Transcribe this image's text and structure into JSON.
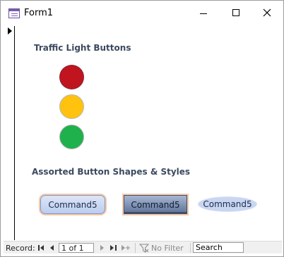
{
  "window": {
    "title": "Form1"
  },
  "form": {
    "traffic_section_label": "Traffic Light Buttons",
    "assorted_section_label": "Assorted Button Shapes & Styles",
    "traffic_lights": [
      {
        "name": "red",
        "color": "#c0151f"
      },
      {
        "name": "amber",
        "color": "#ffc20e"
      },
      {
        "name": "green",
        "color": "#1fb14b"
      }
    ],
    "buttons": [
      {
        "label": "Command5"
      },
      {
        "label": "Command5"
      },
      {
        "label": "Command5"
      }
    ]
  },
  "navigation": {
    "record_label": "Record:",
    "current_record": "1 of 1",
    "filter_label": "No Filter",
    "search_placeholder": "Search"
  }
}
